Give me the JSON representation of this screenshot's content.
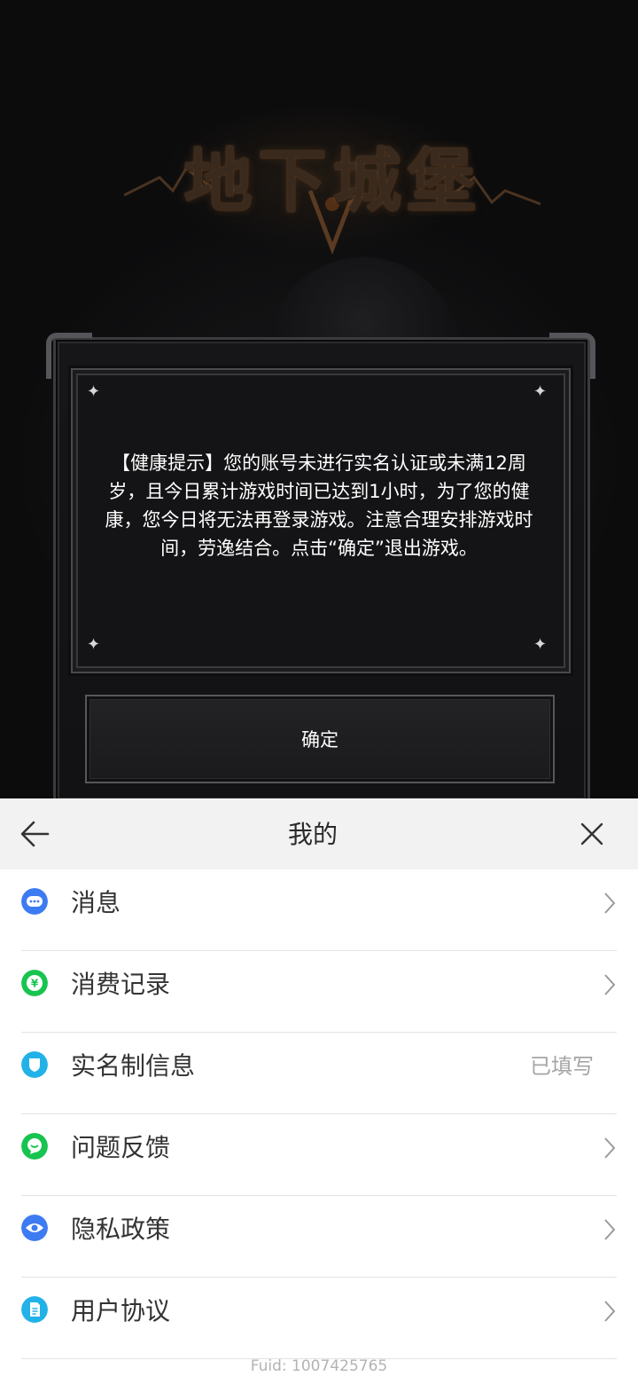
{
  "game": {
    "logo_text": "地下城堡",
    "health_notice": "【健康提示】您的账号未进行实名认证或未满12周岁，且今日累计游戏时间已达到1小时，为了您的健康，您今日将无法再登录游戏。注意合理安排游戏时间，劳逸结合。点击“确定”退出游戏。",
    "confirm_label": "确定"
  },
  "sheet": {
    "title": "我的",
    "back_icon": "arrow-left-icon",
    "close_icon": "close-icon",
    "items": [
      {
        "label": "消息",
        "icon": "chat-bubble-icon",
        "icon_color": "#3d7bf3",
        "chevron": true
      },
      {
        "label": "消费记录",
        "icon": "yen-icon",
        "icon_color": "#17c44f",
        "chevron": true
      },
      {
        "label": "实名制信息",
        "icon": "shield-icon",
        "icon_color": "#22b2e8",
        "status": "已填写"
      },
      {
        "label": "问题反馈",
        "icon": "feedback-icon",
        "icon_color": "#17c44f",
        "chevron": true
      },
      {
        "label": "隐私政策",
        "icon": "eye-icon",
        "icon_color": "#3d7bf3",
        "chevron": true
      },
      {
        "label": "用户协议",
        "icon": "document-icon",
        "icon_color": "#22b2e8",
        "chevron": true
      }
    ],
    "footer": "Fuid: 1007425765"
  }
}
